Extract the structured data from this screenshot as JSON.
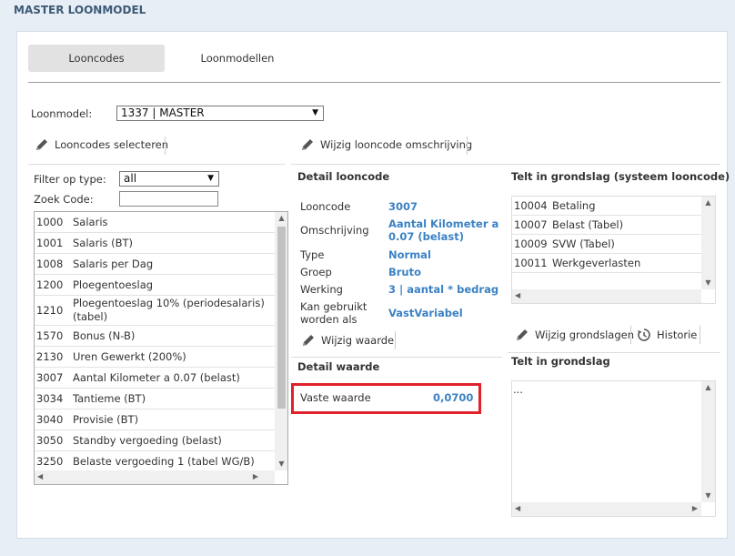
{
  "page": {
    "title": "MASTER LOONMODEL"
  },
  "tabs": [
    {
      "label": "Looncodes",
      "active": true
    },
    {
      "label": "Loonmodellen",
      "active": false
    }
  ],
  "loonmodel": {
    "label": "Loonmodel:",
    "value": "1337 | MASTER"
  },
  "left": {
    "select_button": "Looncodes selecteren",
    "filter_label": "Filter op type:",
    "filter_value": "all",
    "search_label": "Zoek Code:",
    "search_value": "",
    "items": [
      {
        "code": "1000",
        "name": "Salaris"
      },
      {
        "code": "1001",
        "name": "Salaris (BT)"
      },
      {
        "code": "1008",
        "name": "Salaris per Dag"
      },
      {
        "code": "1200",
        "name": "Ploegentoeslag"
      },
      {
        "code": "1210",
        "name": "Ploegentoeslag 10% (periodesalaris) (tabel)"
      },
      {
        "code": "1570",
        "name": "Bonus (N-B)"
      },
      {
        "code": "2130",
        "name": "Uren Gewerkt (200%)"
      },
      {
        "code": "3007",
        "name": "Aantal Kilometer a 0.07 (belast)"
      },
      {
        "code": "3034",
        "name": "Tantieme (BT)"
      },
      {
        "code": "3040",
        "name": "Provisie (BT)"
      },
      {
        "code": "3050",
        "name": "Standby vergoeding (belast)"
      },
      {
        "code": "3250",
        "name": "Belaste vergoeding 1 (tabel WG/B)"
      }
    ]
  },
  "middle": {
    "edit_description_button": "Wijzig looncode omschrijving",
    "detail_title": "Detail looncode",
    "fields": {
      "looncode": {
        "key": "Looncode",
        "value": "3007"
      },
      "omschrijving": {
        "key": "Omschrijving",
        "value": "Aantal Kilometer a 0.07 (belast)"
      },
      "type": {
        "key": "Type",
        "value": "Normal"
      },
      "groep": {
        "key": "Groep",
        "value": "Bruto"
      },
      "werking": {
        "key": "Werking",
        "value": "3 | aantal * bedrag"
      },
      "kan_gebruikt": {
        "key": "Kan gebruikt worden als",
        "value": "VastVariabel"
      }
    },
    "edit_value_button": "Wijzig waarde",
    "detail_value_title": "Detail waarde",
    "vaste_waarde": {
      "key": "Vaste waarde",
      "value": "0,0700"
    }
  },
  "right": {
    "system_title": "Telt in grondslag (systeem looncode)",
    "system_items": [
      {
        "code": "10004",
        "name": "Betaling"
      },
      {
        "code": "10007",
        "name": "Belast (Tabel)"
      },
      {
        "code": "10009",
        "name": "SVW (Tabel)"
      },
      {
        "code": "10011",
        "name": "Werkgeverlasten"
      }
    ],
    "edit_grondslagen_button": "Wijzig grondslagen",
    "history_button": "Historie",
    "grondslag_title": "Telt in grondslag",
    "grondslag_content": "..."
  }
}
